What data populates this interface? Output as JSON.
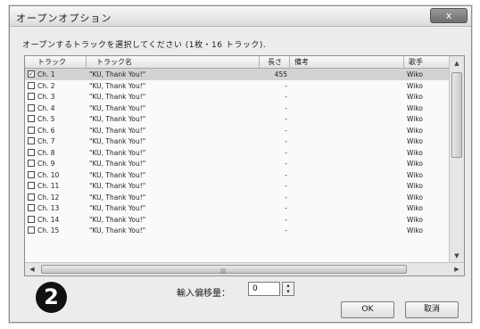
{
  "dialog": {
    "title": "オープンオプション",
    "close_label": "x",
    "instruction": "オープンするトラックを選択してください (1枚・16 トラック)."
  },
  "table": {
    "headers": [
      "トラック",
      "トラック名",
      "長さ",
      "備考",
      "歌手"
    ],
    "rows": [
      {
        "checked": true,
        "track": "Ch.  1",
        "name": "\"KU,  Thank You!\"",
        "time": "455",
        "mark": "",
        "artist": "Wiko"
      },
      {
        "checked": false,
        "track": "Ch.  2",
        "name": "\"KU,  Thank You!\"",
        "time": "-",
        "mark": "",
        "artist": "Wiko"
      },
      {
        "checked": false,
        "track": "Ch.  3",
        "name": "\"KU,  Thank You!\"",
        "time": "-",
        "mark": "",
        "artist": "Wiko"
      },
      {
        "checked": false,
        "track": "Ch.  4",
        "name": "\"KU,  Thank You!\"",
        "time": "-",
        "mark": "",
        "artist": "Wiko"
      },
      {
        "checked": false,
        "track": "Ch.  5",
        "name": "\"KU,  Thank You!\"",
        "time": "-",
        "mark": "",
        "artist": "Wiko"
      },
      {
        "checked": false,
        "track": "Ch.  6",
        "name": "\"KU,  Thank You!\"",
        "time": "-",
        "mark": "",
        "artist": "Wiko"
      },
      {
        "checked": false,
        "track": "Ch.  7",
        "name": "\"KU,  Thank You!\"",
        "time": "-",
        "mark": "",
        "artist": "Wiko"
      },
      {
        "checked": false,
        "track": "Ch.  8",
        "name": "\"KU,  Thank You!\"",
        "time": "-",
        "mark": "",
        "artist": "Wiko"
      },
      {
        "checked": false,
        "track": "Ch.  9",
        "name": "\"KU,  Thank You!\"",
        "time": "-",
        "mark": "",
        "artist": "Wiko"
      },
      {
        "checked": false,
        "track": "Ch.  10",
        "name": "\"KU,  Thank You!\"",
        "time": "-",
        "mark": "",
        "artist": "Wiko"
      },
      {
        "checked": false,
        "track": "Ch.  11",
        "name": "\"KU,  Thank You!\"",
        "time": "-",
        "mark": "",
        "artist": "Wiko"
      },
      {
        "checked": false,
        "track": "Ch.  12",
        "name": "\"KU,  Thank You!\"",
        "time": "-",
        "mark": "",
        "artist": "Wiko"
      },
      {
        "checked": false,
        "track": "Ch.  13",
        "name": "\"KU,  Thank You!\"",
        "time": "-",
        "mark": "",
        "artist": "Wiko"
      },
      {
        "checked": false,
        "track": "Ch.  14",
        "name": "\"KU,  Thank You!\"",
        "time": "-",
        "mark": "",
        "artist": "Wiko"
      },
      {
        "checked": false,
        "track": "Ch.  15",
        "name": "\"KU,  Thank You!\"",
        "time": "-",
        "mark": "",
        "artist": "Wiko"
      }
    ]
  },
  "footer": {
    "badge": "2",
    "offset_label": "輸入偏移量：",
    "offset_value": "0",
    "ok_label": "OK",
    "cancel_label": "取消"
  },
  "icons": {
    "close": "close-icon",
    "check": "✓",
    "scroll_up": "▲",
    "scroll_down": "▼",
    "scroll_left": "◀",
    "scroll_right": "▶",
    "grip": "|||",
    "spin_up": "▴",
    "spin_down": "▾"
  },
  "colors": {
    "selected_row": "#d3d3d3",
    "dialog_bg": "#ececec",
    "close_button": "#7c7c7c"
  }
}
